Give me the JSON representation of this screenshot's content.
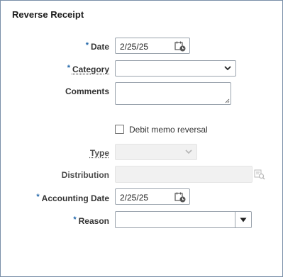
{
  "dialog": {
    "title": "Reverse Receipt"
  },
  "form": {
    "date": {
      "label": "Date",
      "value": "2/25/25",
      "required_mark": "*"
    },
    "category": {
      "label": "Category",
      "value": "",
      "required_mark": "*"
    },
    "comments": {
      "label": "Comments",
      "value": ""
    },
    "debit_memo": {
      "label": "Debit memo reversal",
      "checked": false
    },
    "type": {
      "label": "Type",
      "value": ""
    },
    "distribution": {
      "label": "Distribution",
      "value": ""
    },
    "accounting_date": {
      "label": "Accounting Date",
      "value": "2/25/25",
      "required_mark": "*"
    },
    "reason": {
      "label": "Reason",
      "value": "",
      "required_mark": "*"
    }
  },
  "icons": {
    "calendar": "calendar-icon",
    "dropdown": "chevron-down-icon",
    "search": "search-icon",
    "combo": "triangle-down-icon"
  },
  "colors": {
    "required": "#1f65a8",
    "border": "#9aa3ad",
    "disabled_bg": "#f1f1f1"
  }
}
